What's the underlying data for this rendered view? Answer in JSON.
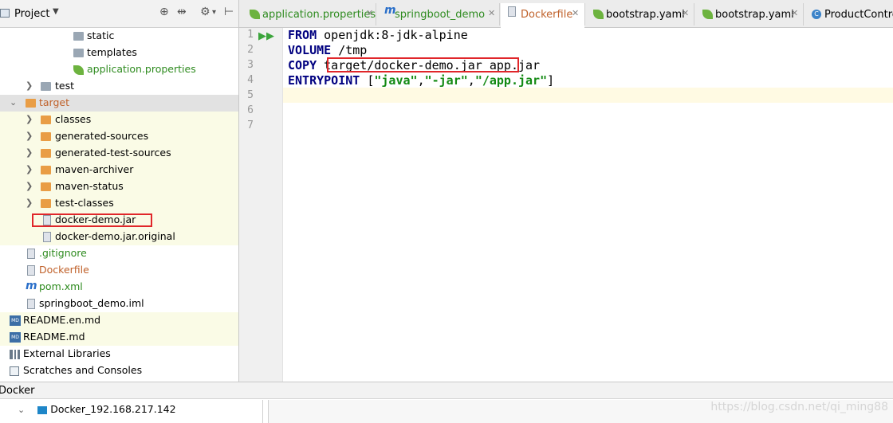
{
  "project_panel": {
    "title": "Project",
    "tree": [
      {
        "label": "static",
        "icon": "folder-gray-icon",
        "indent": 2
      },
      {
        "label": "templates",
        "icon": "folder-gray-icon",
        "indent": 2
      },
      {
        "label": "application.properties",
        "icon": "spring-leaf-icon",
        "indent": 2
      },
      {
        "label": "test",
        "icon": "folder-gray-icon",
        "indent": 1
      },
      {
        "label": "target",
        "icon": "folder-orange-icon",
        "indent": 0
      },
      {
        "label": "classes",
        "icon": "folder-orange-icon",
        "indent": 1
      },
      {
        "label": "generated-sources",
        "icon": "folder-orange-icon",
        "indent": 1
      },
      {
        "label": "generated-test-sources",
        "icon": "folder-orange-icon",
        "indent": 1
      },
      {
        "label": "maven-archiver",
        "icon": "folder-orange-icon",
        "indent": 1
      },
      {
        "label": "maven-status",
        "icon": "folder-orange-icon",
        "indent": 1
      },
      {
        "label": "test-classes",
        "icon": "folder-orange-icon",
        "indent": 1
      },
      {
        "label": "docker-demo.jar",
        "icon": "jar-file-icon",
        "indent": 1
      },
      {
        "label": "docker-demo.jar.original",
        "icon": "file-icon",
        "indent": 1
      },
      {
        "label": ".gitignore",
        "icon": "file-icon",
        "indent": 0
      },
      {
        "label": "Dockerfile",
        "icon": "file-icon",
        "indent": 0
      },
      {
        "label": "pom.xml",
        "icon": "maven-icon",
        "indent": 0
      },
      {
        "label": "springboot_demo.iml",
        "icon": "file-icon",
        "indent": 0
      },
      {
        "label": "README.en.md",
        "icon": "markdown-icon",
        "indent": 0
      },
      {
        "label": "README.md",
        "icon": "markdown-icon",
        "indent": 0
      },
      {
        "label": "External Libraries",
        "icon": "libraries-icon",
        "indent": 0
      },
      {
        "label": "Scratches and Consoles",
        "icon": "scratches-icon",
        "indent": 0
      }
    ]
  },
  "tabs": [
    {
      "label": "application.properties",
      "icon": "spring-leaf-icon"
    },
    {
      "label": "springboot_demo",
      "icon": "maven-icon"
    },
    {
      "label": "Dockerfile",
      "icon": "docker-file-icon",
      "active": true
    },
    {
      "label": "bootstrap.yaml",
      "icon": "spring-leaf-icon"
    },
    {
      "label": "bootstrap.yaml",
      "icon": "spring-leaf-icon"
    },
    {
      "label": "ProductControl",
      "icon": "class-icon"
    }
  ],
  "editor": {
    "line_numbers": [
      "1",
      "2",
      "3",
      "4",
      "5",
      "6",
      "7"
    ],
    "lines": {
      "l1_kw": "FROM",
      "l1_rest": " openjdk:8-jdk-alpine",
      "l2_kw": "VOLUME",
      "l2_rest": " /tmp",
      "l3_kw": "COPY",
      "l3_path": " target/docker-demo.jar ",
      "l3_rest": "app.jar",
      "l4_kw": "ENTRYPOINT",
      "l4_open": " [",
      "l4_s1": "\"java\"",
      "l4_c1": ",",
      "l4_s2": "\"-jar\"",
      "l4_c2": ",",
      "l4_s3": "\"/app.jar\"",
      "l4_close": "]"
    }
  },
  "docker_panel": {
    "title": "Docker",
    "node": "Docker_192.168.217.142"
  },
  "watermark": "https://blog.csdn.net/qi_ming88",
  "colors": {
    "highlight_red": "#e0262a",
    "keyword": "#000080",
    "string": "#138a13"
  }
}
